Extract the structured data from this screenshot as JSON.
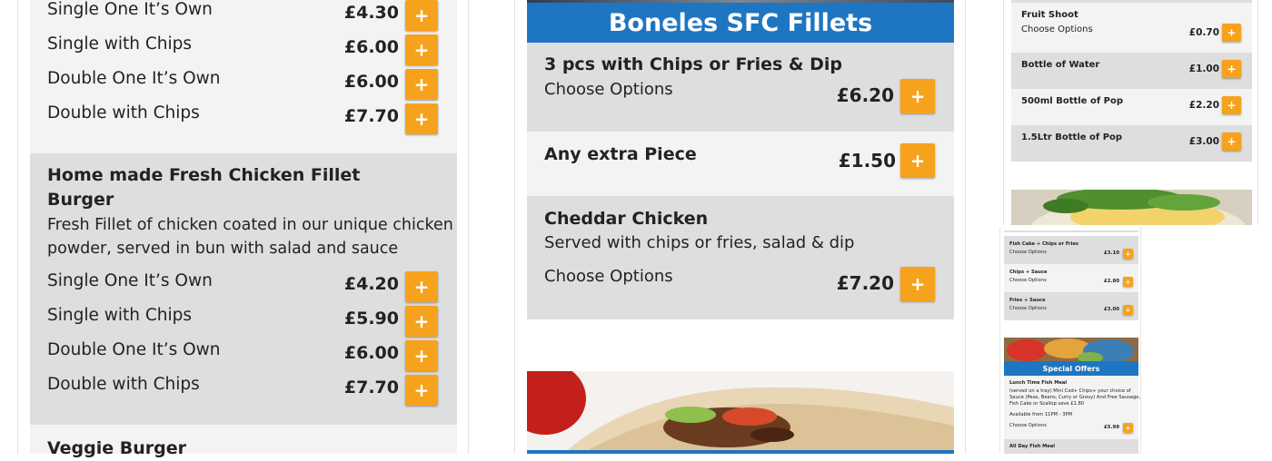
{
  "col1": {
    "top_rows": [
      {
        "name": "Single One It’s Own",
        "price": "£4.30",
        "add": "+"
      },
      {
        "name": "Single with Chips",
        "price": "£6.00",
        "add": "+"
      },
      {
        "name": "Double One It’s Own",
        "price": "£6.00",
        "add": "+"
      },
      {
        "name": "Double with Chips",
        "price": "£7.70",
        "add": "+"
      }
    ],
    "fillet_burger": {
      "title_line1": "Home made Fresh Chicken Fillet",
      "title_line2": "Burger",
      "desc_line1": "Fresh Fillet of chicken coated in our unique chicken",
      "desc_line2": "powder, served in bun with salad and sauce",
      "rows": [
        {
          "name": "Single One It’s Own",
          "price": "£4.20",
          "add": "+"
        },
        {
          "name": "Single with Chips",
          "price": "£5.90",
          "add": "+"
        },
        {
          "name": "Double One It’s Own",
          "price": "£6.00",
          "add": "+"
        },
        {
          "name": "Double with Chips",
          "price": "£7.70",
          "add": "+"
        }
      ]
    },
    "veggie_title": "Veggie Burger"
  },
  "col2": {
    "section_title": "Boneles SFC Fillets",
    "cards": [
      {
        "title": "3 pcs with Chips or Fries & Dip",
        "options": "Choose Options",
        "price": "£6.20",
        "add": "+"
      },
      {
        "title": "Any extra Piece",
        "price": "£1.50",
        "add": "+"
      },
      {
        "title": "Cheddar Chicken",
        "desc": "Served with chips or fries, salad & dip",
        "options": "Choose Options",
        "price": "£7.20",
        "add": "+"
      }
    ]
  },
  "col3": {
    "rows": [
      {
        "name": "Fruit Shoot",
        "sub": "Choose Options",
        "price": "£0.70",
        "add": "+"
      },
      {
        "name": "Bottle of Water",
        "price": "£1.00",
        "add": "+"
      },
      {
        "name": "500ml Bottle of Pop",
        "price": "£2.20",
        "add": "+"
      },
      {
        "name": "1.5Ltr Bottle of Pop",
        "price": "£3.00",
        "add": "+"
      }
    ]
  },
  "col4": {
    "rows": [
      {
        "name": "Fish Cake + Chips or Fries",
        "sub": "Choose Options",
        "price": "£3.10",
        "add": "+"
      },
      {
        "name": "Chips + Sauce",
        "sub": "Choose Options",
        "price": "£2.80",
        "add": "+"
      },
      {
        "name": "Fries + Sauce",
        "sub": "Choose Options",
        "price": "£3.00",
        "add": "+"
      }
    ],
    "offers_title": "Special Offers",
    "lunch": {
      "title": "Lunch Time Fish Meal",
      "desc1": "(served on a tray) Mini Cod+ Chips+ your choice of",
      "desc2": "Sauce (Peas, Beans, Curry or Gravy) And Free Sausage,",
      "desc3": "Fish Cake or Scallop save £1.80",
      "avail": "Available from 11PM - 3PM",
      "options": "Choose Options",
      "price": "£5.99",
      "add": "+"
    },
    "all_day_title": "All Day Fish Meal"
  },
  "colors": {
    "accent": "#f6a21d",
    "header_blue": "#1e76c2",
    "card_gray": "#dedede",
    "card_light": "#f3f3f3"
  }
}
